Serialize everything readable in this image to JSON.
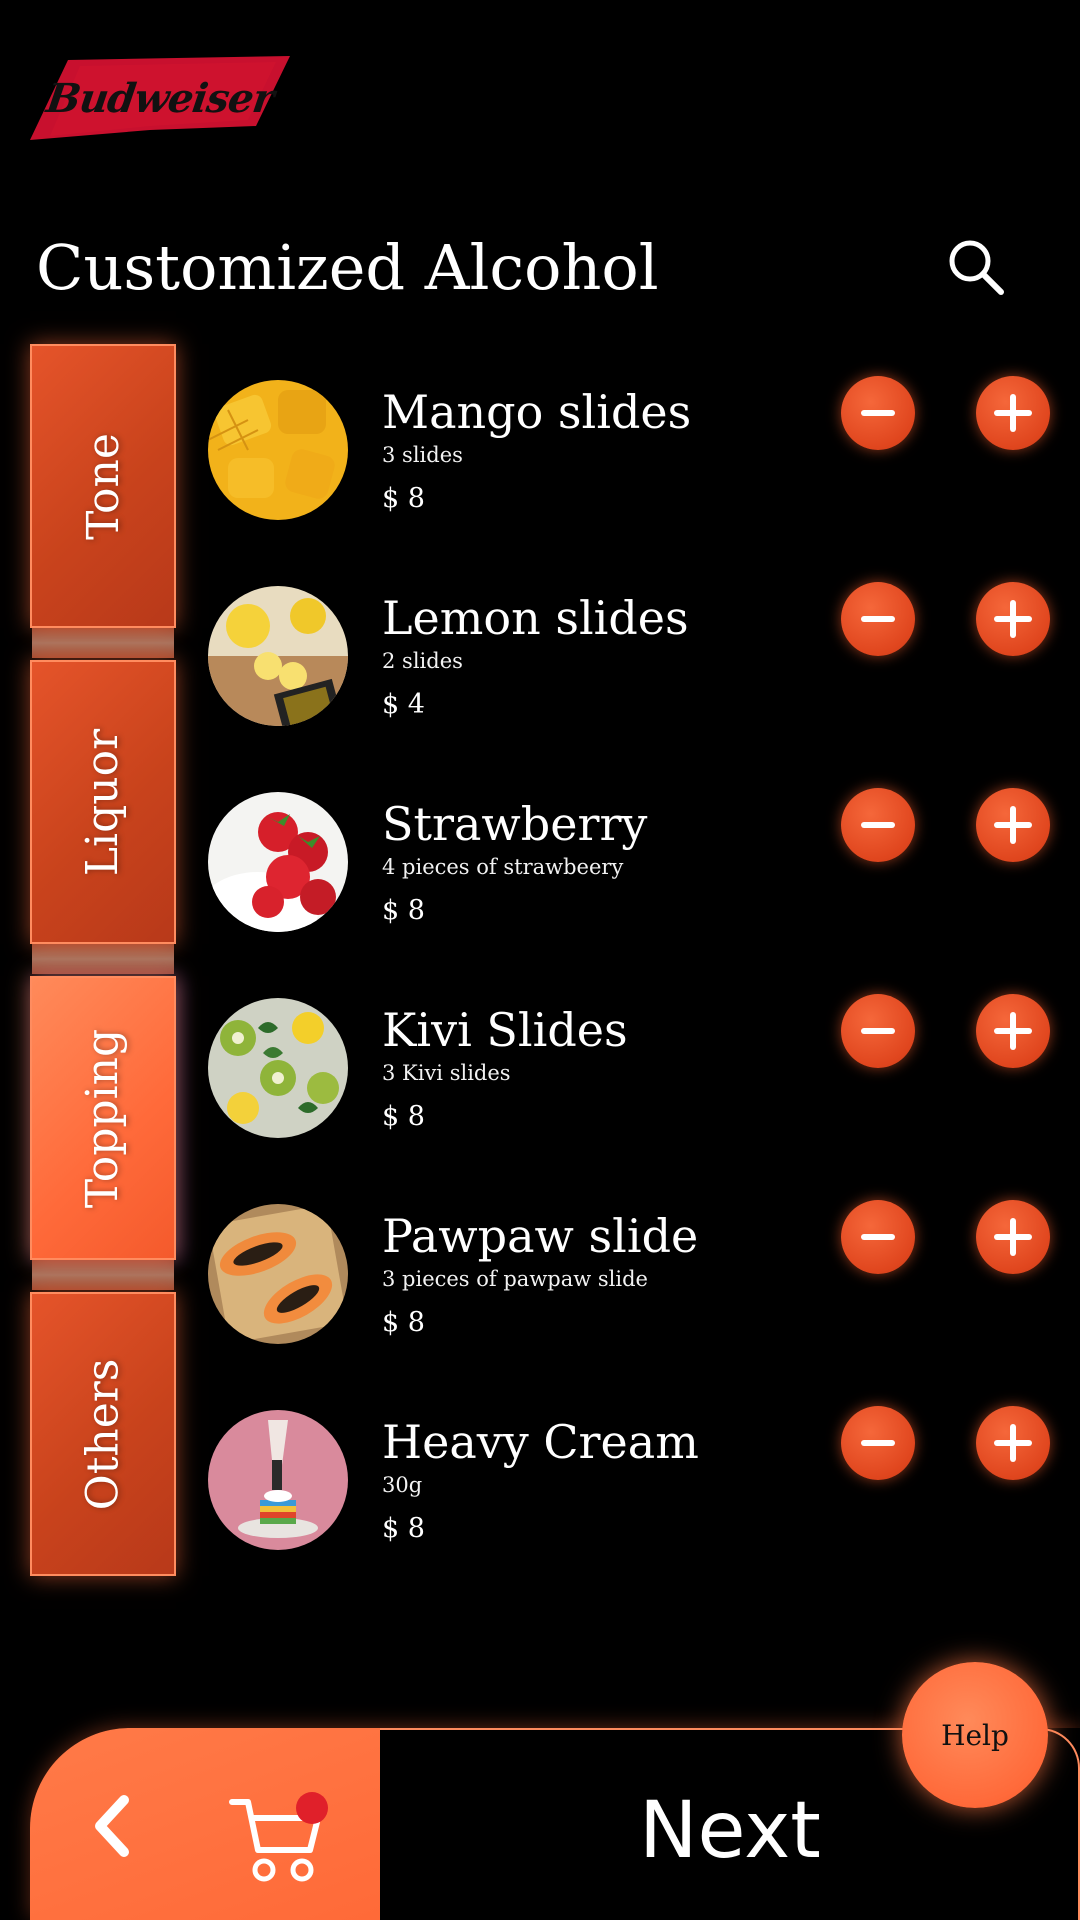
{
  "brand": {
    "logo_text": "Budweiser",
    "logo_color": "#c8102e"
  },
  "header": {
    "title": "Customized Alcohol",
    "search_icon": "search-icon"
  },
  "tabs": [
    {
      "label": "Tone",
      "active": false
    },
    {
      "label": "Liquor",
      "active": false
    },
    {
      "label": "Topping",
      "active": true
    },
    {
      "label": "Others",
      "active": false
    }
  ],
  "items": [
    {
      "name": "Mango slides",
      "desc": "3 slides",
      "price": "$ 8",
      "image": "mango"
    },
    {
      "name": "Lemon slides",
      "desc": "2 slides",
      "price": "$ 4",
      "image": "lemon"
    },
    {
      "name": "Strawberry",
      "desc": "4 pieces of strawbeery",
      "price": "$ 8",
      "image": "strawberry"
    },
    {
      "name": "Kivi Slides",
      "desc": "3 Kivi slides",
      "price": "$ 8",
      "image": "kiwi"
    },
    {
      "name": "Pawpaw slide",
      "desc": "3 pieces of pawpaw slide",
      "price": "$ 8",
      "image": "papaya"
    },
    {
      "name": "Heavy Cream",
      "desc": "30g",
      "price": "$ 8",
      "image": "cream"
    }
  ],
  "bottom_bar": {
    "back_icon": "chevron-left-icon",
    "cart_icon": "cart-icon",
    "next_label": "Next"
  },
  "help": {
    "label": "Help"
  },
  "colors": {
    "accent": "#ff6a38",
    "accent_dark": "#e0461e",
    "badge": "#e0202a",
    "background": "#000000"
  }
}
